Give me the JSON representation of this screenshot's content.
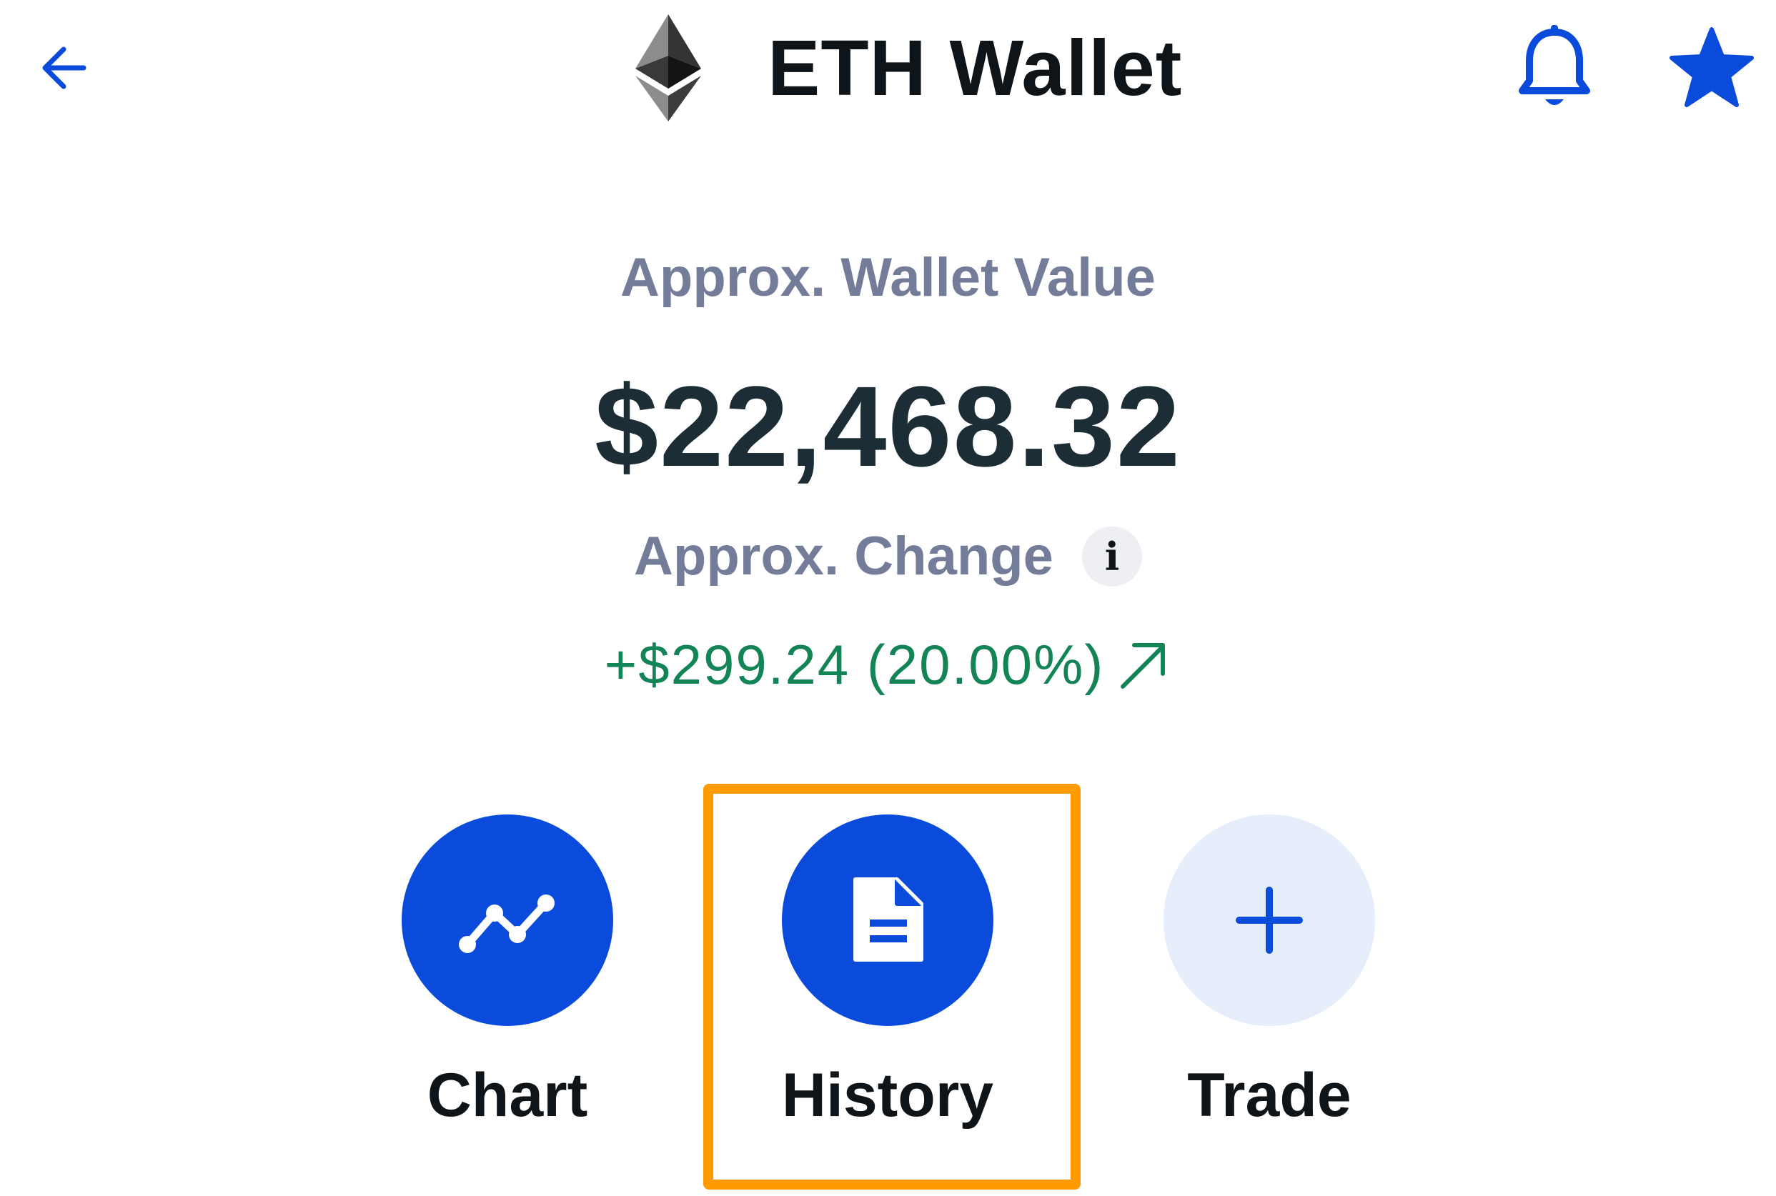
{
  "header": {
    "title": "ETH Wallet",
    "back_icon": "arrow-left-icon",
    "logo_icon": "ethereum-logo-icon",
    "bell_icon": "bell-icon",
    "star_icon": "star-icon"
  },
  "wallet": {
    "label": "Approx. Wallet Value",
    "value": "$22,468.32",
    "change_label": "Approx. Change",
    "info_glyph": "i",
    "change_value": "+$299.24 (20.00%)",
    "change_icon": "arrow-up-right-icon"
  },
  "actions": [
    {
      "label": "Chart",
      "icon": "chart-line-icon"
    },
    {
      "label": "History",
      "icon": "document-icon"
    },
    {
      "label": "Trade",
      "icon": "plus-icon"
    }
  ],
  "colors": {
    "accent_blue": "#0a4bdb",
    "light_blue": "#e6eefc",
    "positive_green": "#128455",
    "muted_text": "#737c99",
    "highlight_orange": "#ff9a00"
  }
}
